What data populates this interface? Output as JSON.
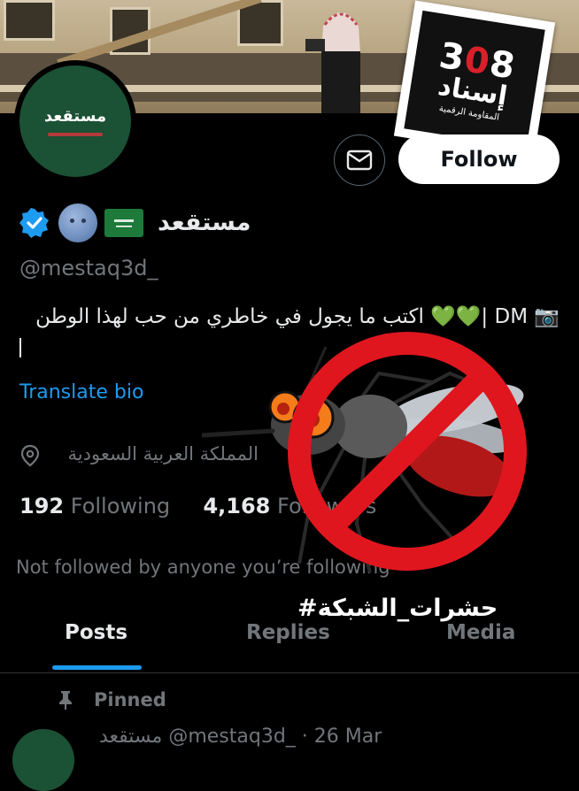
{
  "profile": {
    "display_name": "مستقعد",
    "handle": "@mestaq3d_",
    "avatar_text": "مستقعد",
    "bio_text": "اكتب ما يجول في خاطري من حب لهذا الوطن 💚💚| DM 📷",
    "translate_label": "Translate bio",
    "location": "المملكة العربية السعودية",
    "following_count": "192",
    "following_label": "Following",
    "followers_count": "4,168",
    "followers_label": "Followers",
    "not_followed_text": "Not followed by anyone you’re following"
  },
  "actions": {
    "follow_label": "Follow"
  },
  "tabs": [
    {
      "label": "Posts",
      "active": true
    },
    {
      "label": "Replies",
      "active": false
    },
    {
      "label": "Media",
      "active": false
    }
  ],
  "pinned": {
    "label": "Pinned",
    "post_header_partial": "مستقعد @mestaq3d_ · 26 Mar"
  },
  "overlay": {
    "logo_number": "308",
    "logo_word": "إسناد",
    "logo_subtitle": "المقاومة الرقمية",
    "hashtag": "#حشرات_الشبكة"
  },
  "icons": {
    "verified": "verified-badge-icon",
    "mail": "envelope-icon",
    "location": "location-pin-icon",
    "pin": "pushpin-icon"
  },
  "colors": {
    "background": "#000000",
    "accent": "#1d9bf0",
    "avatar_bg": "#1b5134",
    "no_symbol_red": "#e0161e"
  }
}
